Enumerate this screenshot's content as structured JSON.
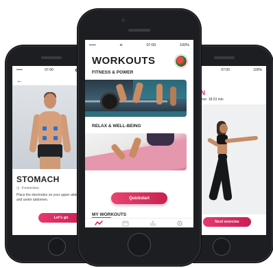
{
  "left_phone": {
    "status": {
      "signal": "•••••",
      "time": "07:00"
    },
    "back_icon": "arrow-left-icon",
    "title": "STOMACH",
    "exercise_count": "4 exercises",
    "description": "Place the electrodes on your upper abdomen and under abdomen.",
    "cta_label": "Let's go"
  },
  "center_phone": {
    "status": {
      "signal": "•••••",
      "time": "07:00",
      "battery": "100%"
    },
    "title": "WORKOUTS",
    "categories": [
      {
        "label": "FITNESS & POWER"
      },
      {
        "label": "RELAX & WELL-BEING"
      }
    ],
    "cta_label": "Quickstart",
    "section_label": "MY WORKOUTS",
    "tabbar": [
      "pulse-icon",
      "calendar-icon",
      "stats-icon",
      "settings-icon"
    ],
    "accent": "#e0275a"
  },
  "right_phone": {
    "status": {
      "time": "07:00",
      "battery": "100%"
    },
    "title": "IN",
    "subtitle": "Time: 18:23 min",
    "cta_label": "Next exercise"
  }
}
